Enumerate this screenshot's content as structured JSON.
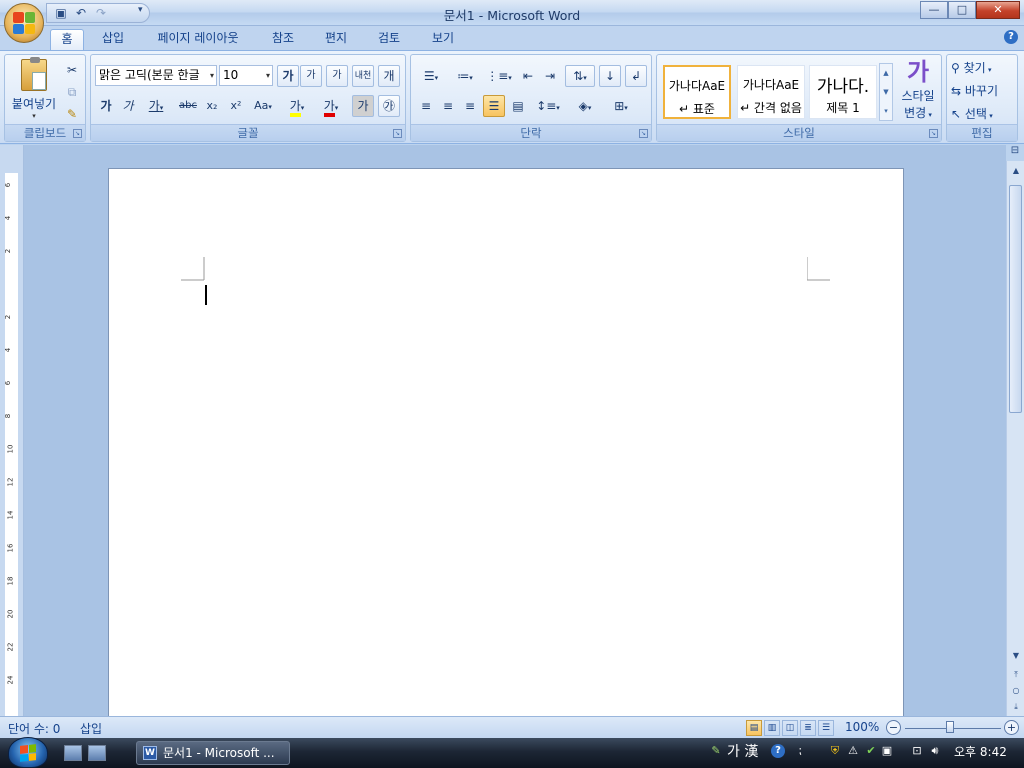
{
  "window": {
    "title": "문서1 - Microsoft Word",
    "qat_icons": [
      "save-icon",
      "undo-icon",
      "redo-icon"
    ],
    "buttons": {
      "minimize": "—",
      "maximize": "□",
      "close": "✕"
    }
  },
  "tabs": [
    "홈",
    "삽입",
    "페이지 레이아웃",
    "참조",
    "편지",
    "검토",
    "보기"
  ],
  "active_tab": "홈",
  "help": "?",
  "ribbon": {
    "clipboard": {
      "label": "클립보드",
      "paste": "붙여넣기"
    },
    "font": {
      "label": "글꼴",
      "font_name": "맑은 고딕(본문 한글",
      "font_size": "10",
      "grow": "가",
      "shrink": "가",
      "clear": "가",
      "phonetic": "내천",
      "charbox": "개",
      "bold": "가",
      "italic": "가",
      "underline": "가",
      "strike": "abc",
      "subscript": "x₂",
      "superscript": "x²",
      "change_case": "Aa",
      "highlight": "가",
      "font_color": "가",
      "shade": "가",
      "enclose": "㉮"
    },
    "paragraph": {
      "label": "단락"
    },
    "styles": {
      "label": "스타일",
      "items": [
        {
          "sample": "가나다AaE",
          "name": "↵ 표준"
        },
        {
          "sample": "가나다AaE",
          "name": "↵ 간격 없음"
        },
        {
          "sample": "가나다.",
          "name": "제목 1"
        }
      ],
      "change_glyph": "가",
      "change_line1": "스타일",
      "change_line2": "변경"
    },
    "editing": {
      "label": "편집",
      "find": "찾기",
      "replace": "바꾸기",
      "select": "선택"
    }
  },
  "ruler_numbers": [
    "6",
    "4",
    "2",
    "2",
    "4",
    "6",
    "8",
    "10",
    "12",
    "14",
    "16",
    "18",
    "20",
    "22",
    "24",
    "26"
  ],
  "statusbar": {
    "word_count": "단어 수: 0",
    "mode": "삽입",
    "zoom": "100%",
    "zoom_minus": "−",
    "zoom_plus": "+"
  },
  "taskbar": {
    "task_label": "문서1 - Microsoft ...",
    "ime": "가 漢",
    "clock": "오후 8:42"
  },
  "colors": {
    "accent": "#15428b",
    "highlight_yellow": "#ffff00",
    "font_red": "#e00000",
    "active_style_border": "#f0b23c"
  }
}
